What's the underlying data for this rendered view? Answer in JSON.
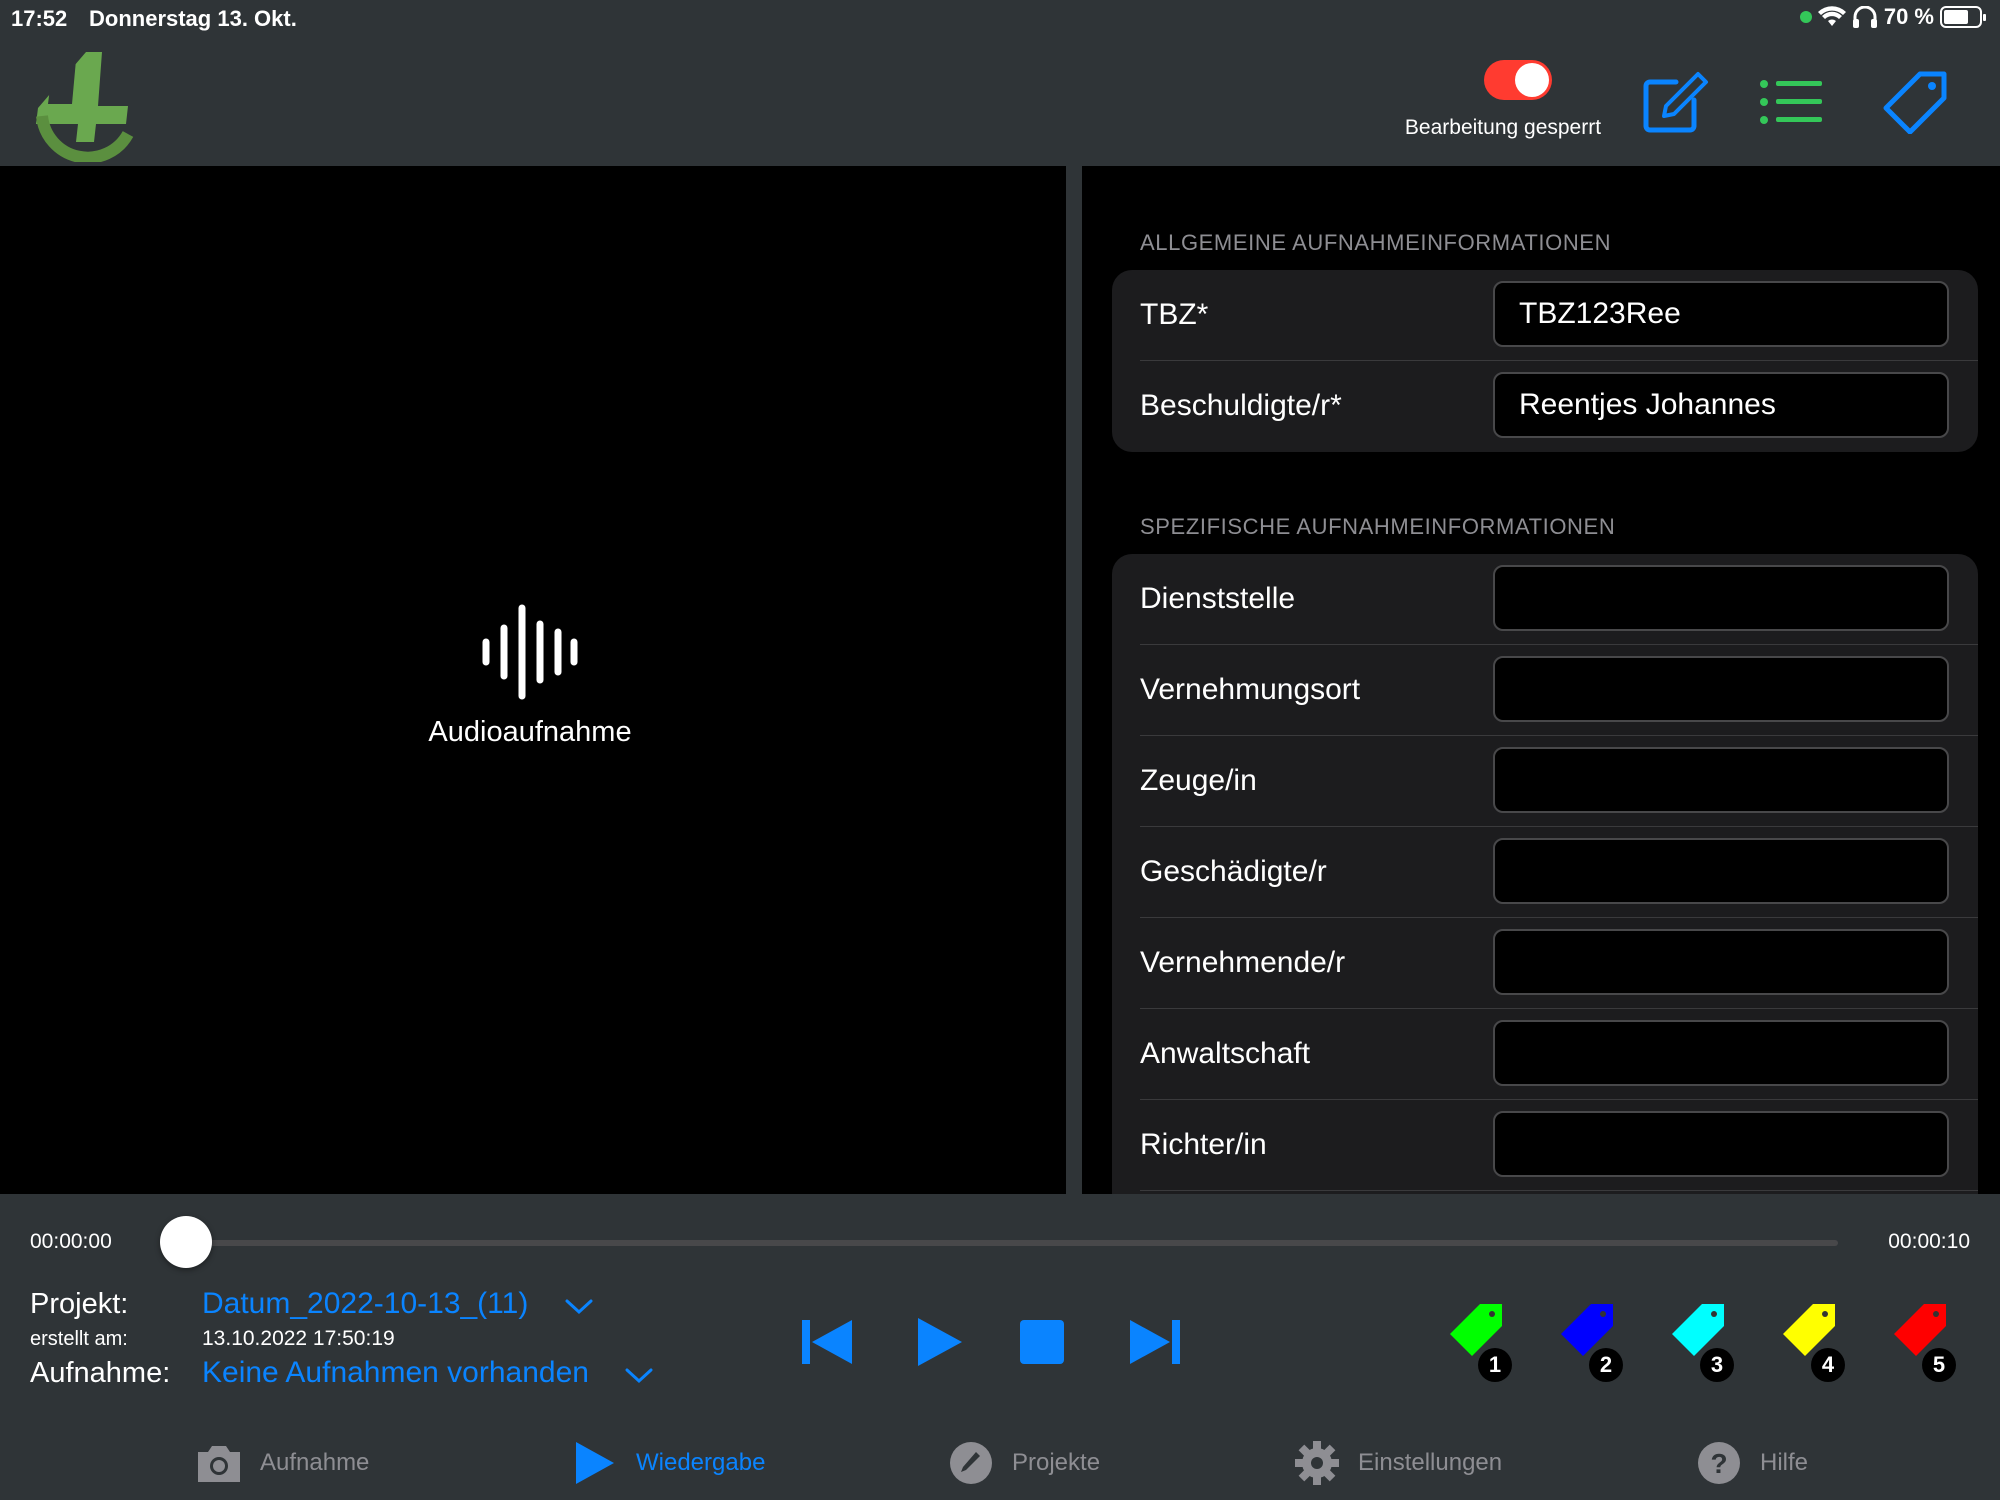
{
  "status_bar": {
    "time": "17:52",
    "date": "Donnerstag 13. Okt.",
    "battery_percent_label": "70 %",
    "battery_level": 0.7
  },
  "header": {
    "logo_icon": "app-logo-icon",
    "lock_toggle_on": true,
    "lock_label": "Bearbeitung gesperrt",
    "icons": [
      "edit-icon",
      "list-icon",
      "tag-icon"
    ],
    "accent_color": "#0a84ff",
    "toggle_color": "#ff3b30"
  },
  "media": {
    "icon": "waveform-icon",
    "label": "Audioaufnahme"
  },
  "general_section": {
    "title": "ALLGEMEINE AUFNAHMEINFORMATIONEN",
    "rows": [
      {
        "label": "TBZ*",
        "value": "TBZ123Ree"
      },
      {
        "label": "Beschuldigte/r*",
        "value": "Reentjes Johannes"
      }
    ]
  },
  "specific_section": {
    "title": "SPEZIFISCHE AUFNAHMEINFORMATIONEN",
    "rows": [
      {
        "label": "Dienststelle",
        "value": ""
      },
      {
        "label": "Vernehmungsort",
        "value": ""
      },
      {
        "label": "Zeuge/in",
        "value": ""
      },
      {
        "label": "Geschädigte/r",
        "value": ""
      },
      {
        "label": "Vernehmende/r",
        "value": ""
      },
      {
        "label": "Anwaltschaft",
        "value": ""
      },
      {
        "label": "Richter/in",
        "value": ""
      }
    ]
  },
  "player": {
    "time_start": "00:00:00",
    "time_end": "00:00:10",
    "progress": 0,
    "project_key": "Projekt:",
    "project_value": "Datum_2022-10-13_(11)",
    "created_key": "erstellt am:",
    "created_value": "13.10.2022 17:50:19",
    "recording_key": "Aufnahme:",
    "recording_value": "Keine Aufnahmen vorhanden",
    "controls": [
      "skip-back-icon",
      "play-icon",
      "stop-icon",
      "skip-forward-icon"
    ],
    "tags": [
      {
        "num": "1",
        "color": "#00ff00"
      },
      {
        "num": "2",
        "color": "#0000ff"
      },
      {
        "num": "3",
        "color": "#00ffff"
      },
      {
        "num": "4",
        "color": "#ffff00"
      },
      {
        "num": "5",
        "color": "#ff0000"
      }
    ]
  },
  "tabbar": [
    {
      "label": "Aufnahme",
      "icon": "camera-icon",
      "active": false
    },
    {
      "label": "Wiedergabe",
      "icon": "play-icon",
      "active": true
    },
    {
      "label": "Projekte",
      "icon": "pencil-icon",
      "active": false
    },
    {
      "label": "Einstellungen",
      "icon": "gear-icon",
      "active": false
    },
    {
      "label": "Hilfe",
      "icon": "help-icon",
      "active": false
    }
  ]
}
